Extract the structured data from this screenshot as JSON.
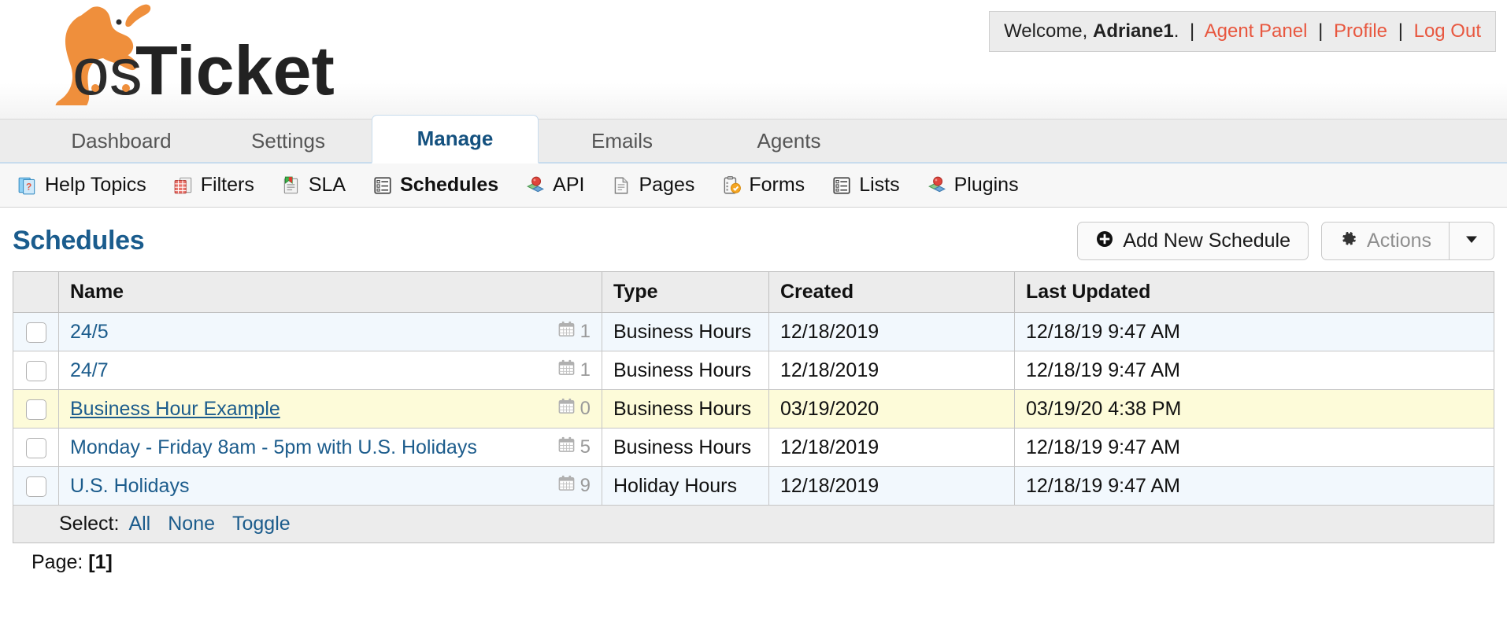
{
  "header": {
    "logo_text": "osTicket",
    "logo_icon": "kangaroo-logo",
    "welcome_prefix": "Welcome,",
    "username": "Adriane1",
    "welcome_suffix": ".",
    "divider": "|",
    "links": [
      {
        "label": "Agent Panel",
        "name": "agent-panel-link"
      },
      {
        "label": "Profile",
        "name": "profile-link"
      },
      {
        "label": "Log Out",
        "name": "log-out-link"
      }
    ],
    "link_color": "#e8573f"
  },
  "tabs": [
    {
      "label": "Dashboard",
      "active": false
    },
    {
      "label": "Settings",
      "active": false
    },
    {
      "label": "Manage",
      "active": true
    },
    {
      "label": "Emails",
      "active": false
    },
    {
      "label": "Agents",
      "active": false
    }
  ],
  "subnav": [
    {
      "label": "Help Topics",
      "icon": "help-topic-icon",
      "active": false
    },
    {
      "label": "Filters",
      "icon": "filter-icon",
      "active": false
    },
    {
      "label": "SLA",
      "icon": "sla-icon",
      "active": false
    },
    {
      "label": "Schedules",
      "icon": "schedule-icon",
      "active": true
    },
    {
      "label": "API",
      "icon": "api-icon",
      "active": false
    },
    {
      "label": "Pages",
      "icon": "pages-icon",
      "active": false
    },
    {
      "label": "Forms",
      "icon": "forms-icon",
      "active": false
    },
    {
      "label": "Lists",
      "icon": "lists-icon",
      "active": false
    },
    {
      "label": "Plugins",
      "icon": "plugins-icon",
      "active": false
    }
  ],
  "page": {
    "title": "Schedules",
    "title_color": "#1a5c8d"
  },
  "toolbar": {
    "add_label": "Add New Schedule",
    "add_icon": "plus-circle-icon",
    "actions_label": "Actions",
    "actions_icon": "gear-icon",
    "caret_icon": "chevron-down-icon"
  },
  "table": {
    "columns": [
      "Name",
      "Type",
      "Created",
      "Last Updated"
    ],
    "rows": [
      {
        "name": "24/5",
        "count": "1",
        "count_icon": "calendar-icon",
        "type": "Business Hours",
        "created": "12/18/2019",
        "updated": "12/18/19 9:47 AM",
        "highlight": false,
        "underline": false
      },
      {
        "name": "24/7",
        "count": "1",
        "count_icon": "calendar-icon",
        "type": "Business Hours",
        "created": "12/18/2019",
        "updated": "12/18/19 9:47 AM",
        "highlight": false,
        "underline": false
      },
      {
        "name": "Business Hour Example",
        "count": "0",
        "count_icon": "calendar-icon",
        "type": "Business Hours",
        "created": "03/19/2020",
        "updated": "03/19/20 4:38 PM",
        "highlight": true,
        "underline": true
      },
      {
        "name": "Monday - Friday 8am - 5pm with U.S. Holidays",
        "count": "5",
        "count_icon": "calendar-icon",
        "type": "Business Hours",
        "created": "12/18/2019",
        "updated": "12/18/19 9:47 AM",
        "highlight": false,
        "underline": false
      },
      {
        "name": "U.S. Holidays",
        "count": "9",
        "count_icon": "calendar-icon",
        "type": "Holiday Hours",
        "created": "12/18/2019",
        "updated": "12/18/19 9:47 AM",
        "highlight": false,
        "underline": false
      }
    ]
  },
  "footer": {
    "select_label": "Select:",
    "select_links": [
      "All",
      "None",
      "Toggle"
    ],
    "page_label": "Page:",
    "page_number": "[1]"
  }
}
